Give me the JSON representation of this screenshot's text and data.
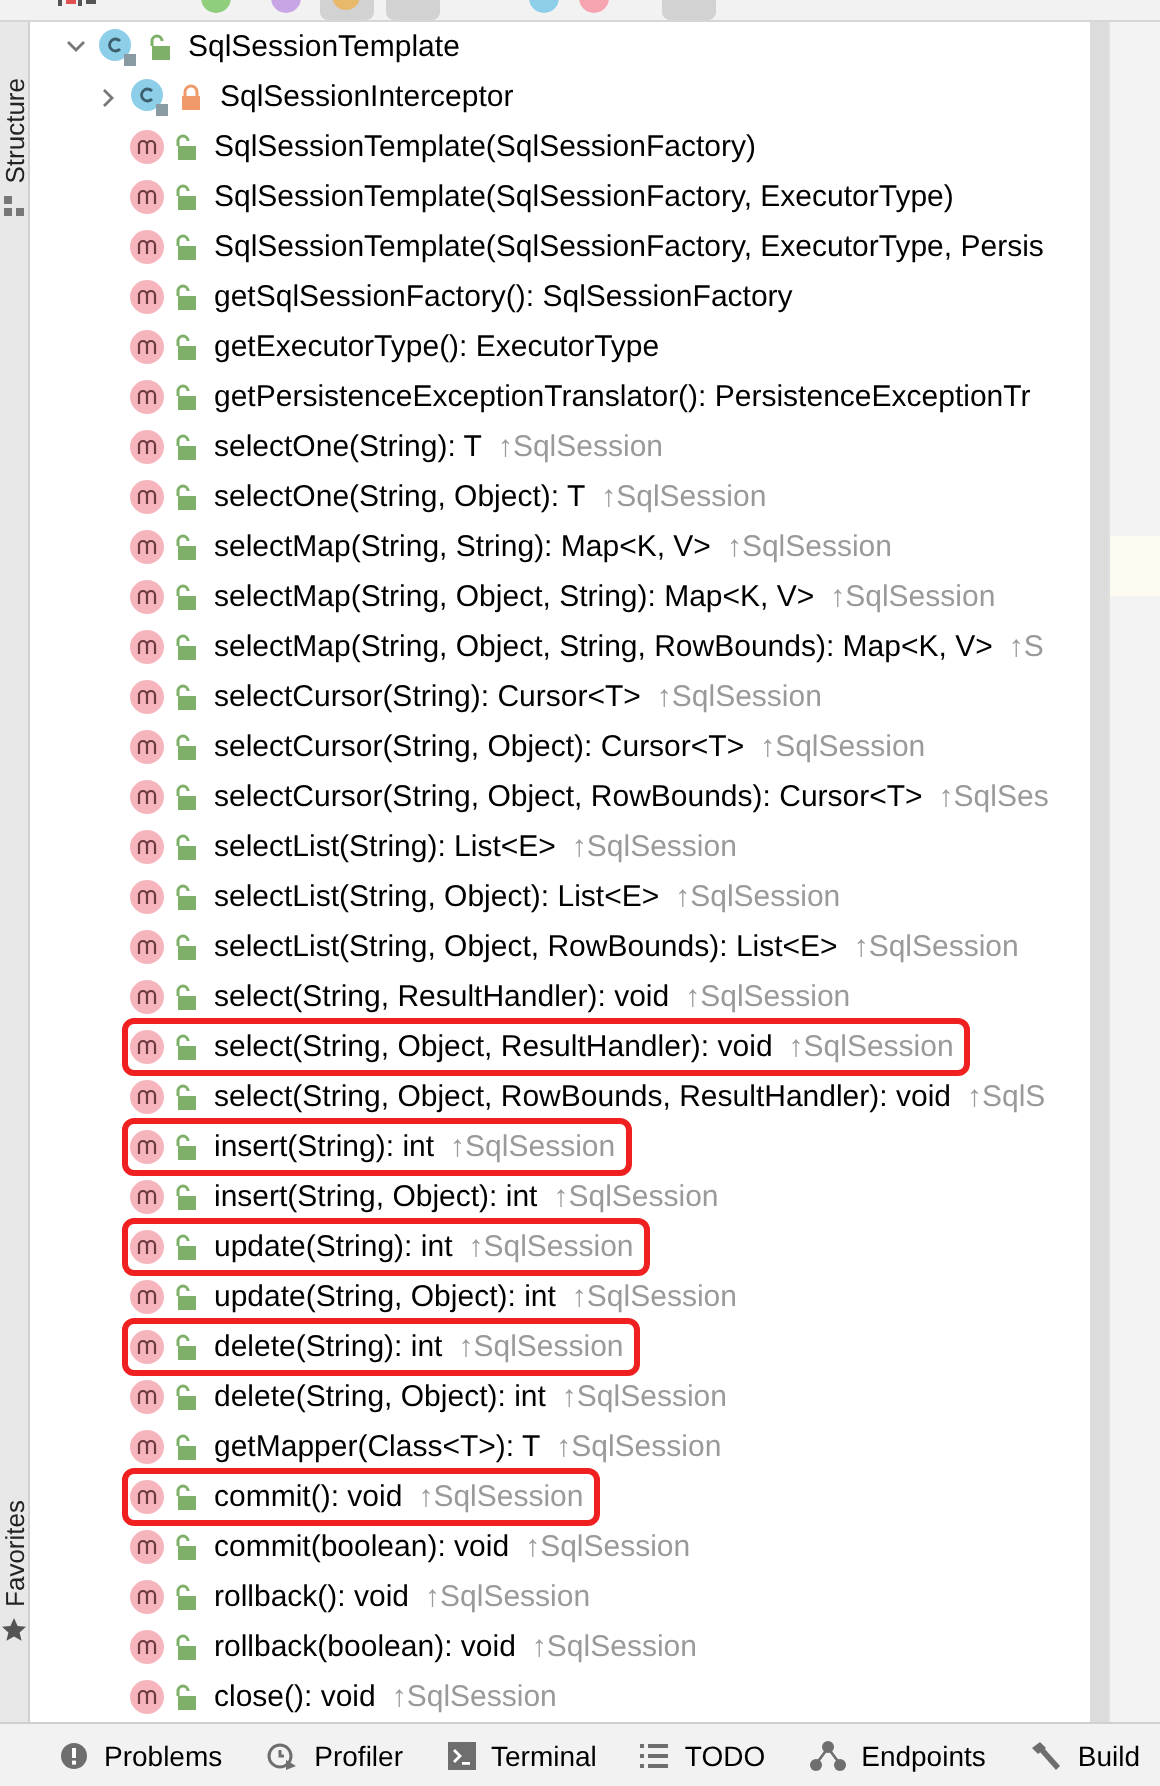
{
  "side_tabs": [
    {
      "label": "Structure"
    },
    {
      "label": "Favorites"
    }
  ],
  "tree": {
    "label": "SqlSessionTemplate",
    "kind": "class",
    "private": false,
    "expanded": true,
    "children": [
      {
        "label": "SqlSessionInterceptor",
        "kind": "class",
        "private": true,
        "expanded": false,
        "circled": false
      },
      {
        "label": "SqlSessionTemplate(SqlSessionFactory)",
        "kind": "method",
        "private": false,
        "circled": false
      },
      {
        "label": "SqlSessionTemplate(SqlSessionFactory, ExecutorType)",
        "kind": "method",
        "private": false,
        "circled": false
      },
      {
        "label": "SqlSessionTemplate(SqlSessionFactory, ExecutorType, Persis",
        "kind": "method",
        "private": false,
        "circled": false
      },
      {
        "label": "getSqlSessionFactory(): SqlSessionFactory",
        "kind": "method",
        "private": false,
        "circled": false
      },
      {
        "label": "getExecutorType(): ExecutorType",
        "kind": "method",
        "private": false,
        "circled": false
      },
      {
        "label": "getPersistenceExceptionTranslator(): PersistenceExceptionTr",
        "kind": "method",
        "private": false,
        "circled": false
      },
      {
        "label": "selectOne(String): T",
        "inherited": "↑SqlSession",
        "kind": "method",
        "private": false,
        "circled": false
      },
      {
        "label": "selectOne(String, Object): T",
        "inherited": "↑SqlSession",
        "kind": "method",
        "private": false,
        "circled": false
      },
      {
        "label": "selectMap(String, String): Map<K, V>",
        "inherited": "↑SqlSession",
        "kind": "method",
        "private": false,
        "circled": false
      },
      {
        "label": "selectMap(String, Object, String): Map<K, V>",
        "inherited": "↑SqlSession",
        "kind": "method",
        "private": false,
        "circled": false
      },
      {
        "label": "selectMap(String, Object, String, RowBounds): Map<K, V>",
        "inherited": "↑S",
        "kind": "method",
        "private": false,
        "circled": false
      },
      {
        "label": "selectCursor(String): Cursor<T>",
        "inherited": "↑SqlSession",
        "kind": "method",
        "private": false,
        "circled": false
      },
      {
        "label": "selectCursor(String, Object): Cursor<T>",
        "inherited": "↑SqlSession",
        "kind": "method",
        "private": false,
        "circled": false
      },
      {
        "label": "selectCursor(String, Object, RowBounds): Cursor<T>",
        "inherited": "↑SqlSes",
        "kind": "method",
        "private": false,
        "circled": false
      },
      {
        "label": "selectList(String): List<E>",
        "inherited": "↑SqlSession",
        "kind": "method",
        "private": false,
        "circled": false
      },
      {
        "label": "selectList(String, Object): List<E>",
        "inherited": "↑SqlSession",
        "kind": "method",
        "private": false,
        "circled": false
      },
      {
        "label": "selectList(String, Object, RowBounds): List<E>",
        "inherited": "↑SqlSession",
        "kind": "method",
        "private": false,
        "circled": false
      },
      {
        "label": "select(String, ResultHandler): void",
        "inherited": "↑SqlSession",
        "kind": "method",
        "private": false,
        "circled": false
      },
      {
        "label": "select(String, Object, ResultHandler): void",
        "inherited": "↑SqlSession",
        "kind": "method",
        "private": false,
        "circled": true
      },
      {
        "label": "select(String, Object, RowBounds, ResultHandler): void",
        "inherited": "↑SqlS",
        "kind": "method",
        "private": false,
        "circled": false
      },
      {
        "label": "insert(String): int",
        "inherited": "↑SqlSession",
        "kind": "method",
        "private": false,
        "circled": true
      },
      {
        "label": "insert(String, Object): int",
        "inherited": "↑SqlSession",
        "kind": "method",
        "private": false,
        "circled": false
      },
      {
        "label": "update(String): int",
        "inherited": "↑SqlSession",
        "kind": "method",
        "private": false,
        "circled": true
      },
      {
        "label": "update(String, Object): int",
        "inherited": "↑SqlSession",
        "kind": "method",
        "private": false,
        "circled": false
      },
      {
        "label": "delete(String): int",
        "inherited": "↑SqlSession",
        "kind": "method",
        "private": false,
        "circled": true
      },
      {
        "label": "delete(String, Object): int",
        "inherited": "↑SqlSession",
        "kind": "method",
        "private": false,
        "circled": false
      },
      {
        "label": "getMapper(Class<T>): T",
        "inherited": "↑SqlSession",
        "kind": "method",
        "private": false,
        "circled": false
      },
      {
        "label": "commit(): void",
        "inherited": "↑SqlSession",
        "kind": "method",
        "private": false,
        "circled": true
      },
      {
        "label": "commit(boolean): void",
        "inherited": "↑SqlSession",
        "kind": "method",
        "private": false,
        "circled": false
      },
      {
        "label": "rollback(): void",
        "inherited": "↑SqlSession",
        "kind": "method",
        "private": false,
        "circled": false
      },
      {
        "label": "rollback(boolean): void",
        "inherited": "↑SqlSession",
        "kind": "method",
        "private": false,
        "circled": false
      },
      {
        "label": "close(): void",
        "inherited": "↑SqlSession",
        "kind": "method",
        "private": false,
        "circled": false
      }
    ]
  },
  "bottom_tabs": [
    {
      "label": "Problems"
    },
    {
      "label": "Profiler"
    },
    {
      "label": "Terminal"
    },
    {
      "label": "TODO"
    },
    {
      "label": "Endpoints"
    },
    {
      "label": "Build"
    }
  ]
}
